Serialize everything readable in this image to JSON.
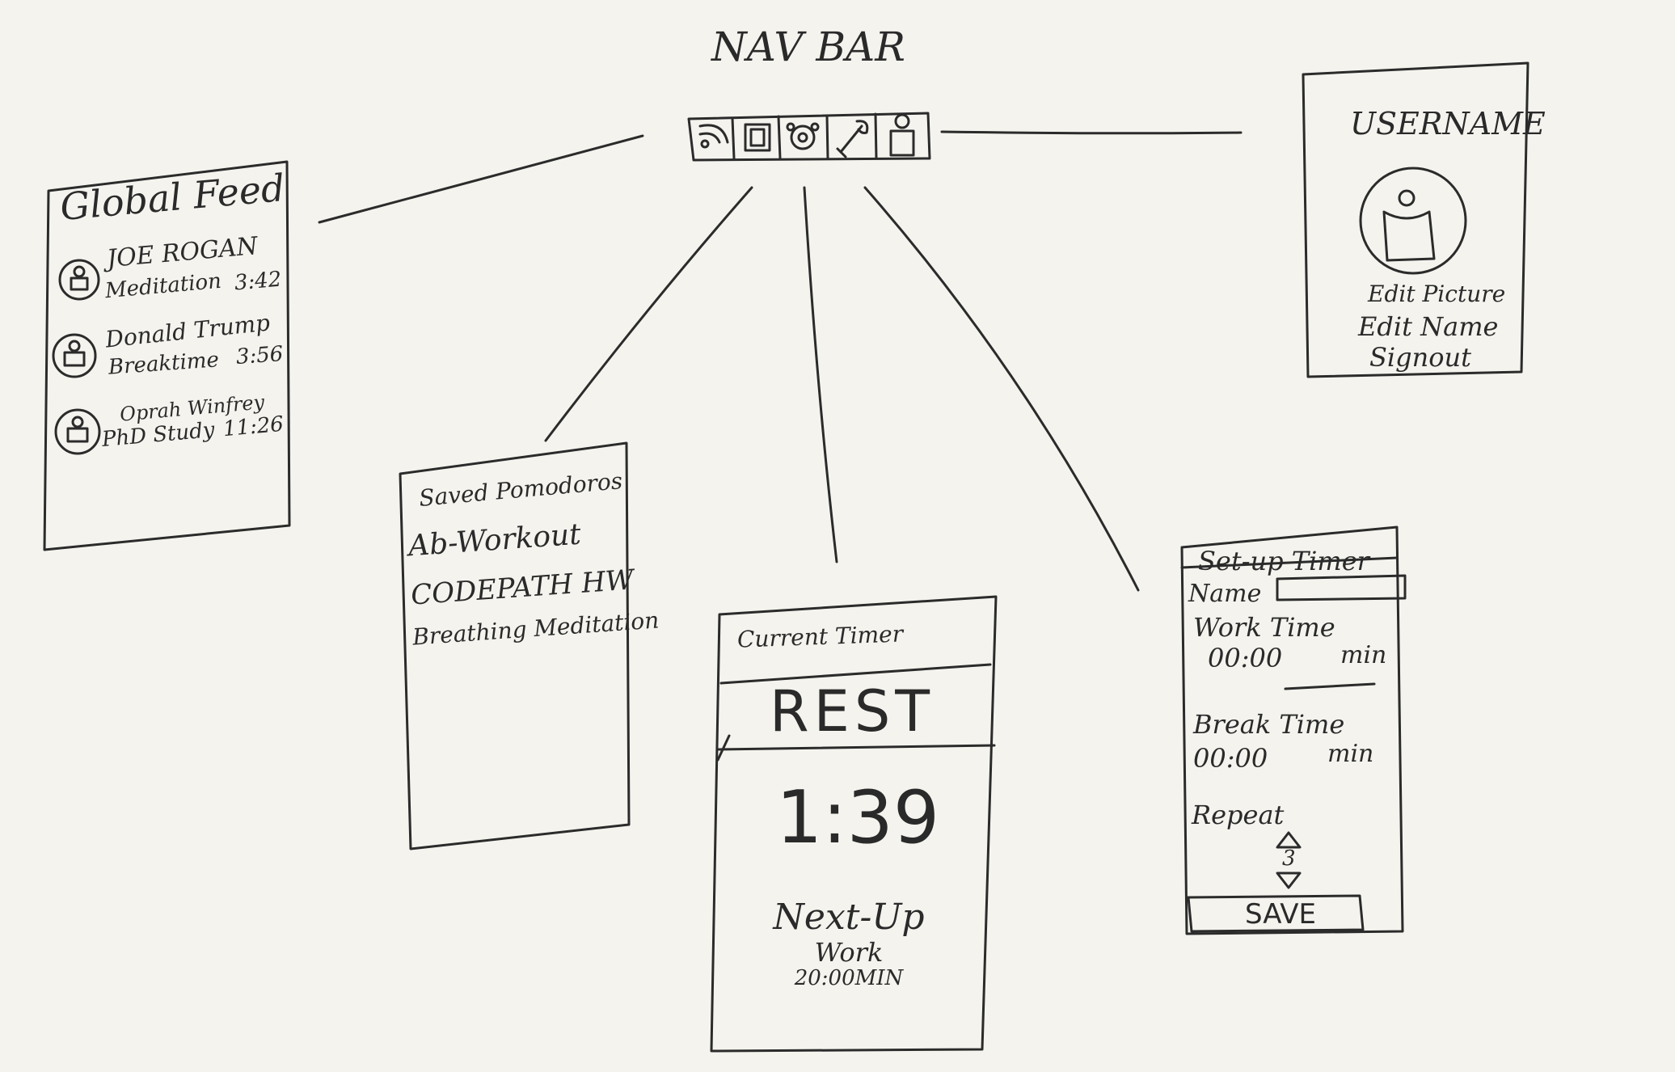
{
  "nav": {
    "label": "NAV BAR",
    "icons": [
      "feed-icon",
      "saved-pomodoros-icon",
      "current-timer-icon",
      "setup-timer-icon",
      "profile-icon"
    ]
  },
  "global_feed": {
    "title": "Global Feed",
    "items": [
      {
        "name": "JOE ROGAN",
        "activity": "Meditation",
        "time": "3:42"
      },
      {
        "name": "Donald Trump",
        "activity": "Breaktime",
        "time": "3:56"
      },
      {
        "name": "Oprah Winfrey",
        "activity": "PhD Study",
        "time": "11:26"
      }
    ]
  },
  "saved": {
    "title": "Saved Pomodoros",
    "items": [
      "Ab-Workout",
      "CODEPATH HW",
      "Breathing Meditation"
    ]
  },
  "current_timer": {
    "title": "Current Timer",
    "mode": "REST",
    "time": "1:39",
    "next_label": "Next-Up",
    "next_mode": "Work",
    "next_duration": "20:00MIN"
  },
  "setup": {
    "title": "Set-up Timer",
    "name_label": "Name",
    "work_label": "Work Time",
    "work_value": "00:00",
    "work_unit": "min",
    "break_label": "Break Time",
    "break_value": "00:00",
    "break_unit": "min",
    "repeat_label": "Repeat",
    "repeat_value": "3",
    "save_label": "SAVE"
  },
  "profile": {
    "username": "USERNAME",
    "edit_picture": "Edit Picture",
    "edit_name": "Edit Name",
    "signout": "Signout"
  }
}
